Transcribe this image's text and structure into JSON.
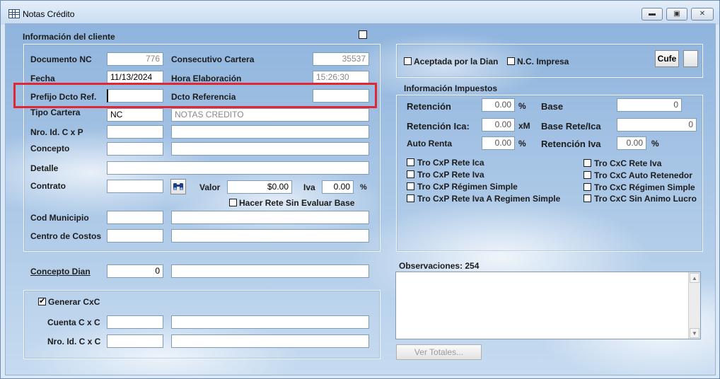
{
  "window": {
    "title": "Notas Crédito",
    "minimize_glyph": "▬",
    "restore_glyph": "▣",
    "close_glyph": "✕"
  },
  "cliente": {
    "title": "Información del cliente",
    "documento_nc_label": "Documento NC",
    "documento_nc_value": "776",
    "consecutivo_label": "Consecutivo Cartera",
    "consecutivo_value": "35537",
    "fecha_label": "Fecha",
    "fecha_value": "11/13/2024",
    "hora_label": "Hora Elaboración",
    "hora_value": "15:26:30",
    "prefijo_label": "Prefijo Dcto Ref.",
    "prefijo_value": "",
    "dcto_ref_label": "Dcto Referencia",
    "dcto_ref_value": "",
    "tipo_cartera_label": "Tipo Cartera",
    "tipo_cartera_code": "NC",
    "tipo_cartera_desc": "NOTAS CREDITO",
    "nro_id_label": "Nro. Id.  C x P",
    "nro_id_value": "",
    "nro_id_desc": "",
    "concepto_label": "Concepto",
    "concepto_value": "",
    "concepto_desc": "",
    "detalle_label": "Detalle",
    "detalle_value": "",
    "contrato_label": "Contrato",
    "contrato_value": "",
    "search_icon": "binoculars-icon",
    "valor_label": "Valor",
    "valor_value": "$0.00",
    "iva_label": "Iva",
    "iva_value": "0.00",
    "iva_unit": "%",
    "hacer_rete_label": "Hacer Rete Sin Evaluar Base",
    "hacer_rete_checked": false,
    "cod_municipio_label": "Cod Municipio",
    "cod_municipio_value": "",
    "cod_municipio_desc": "",
    "centro_costos_label": "Centro de Costos",
    "centro_costos_value": "",
    "centro_costos_desc": ""
  },
  "concepto_dian": {
    "label": "Concepto Dian",
    "value": "0",
    "desc": ""
  },
  "cxc": {
    "generar_label": "Generar CxC",
    "generar_checked": true,
    "cuenta_label": "Cuenta C x C",
    "cuenta_value": "",
    "cuenta_desc": "",
    "nro_id_label": "Nro. Id.  C x C",
    "nro_id_value": "",
    "nro_id_desc": ""
  },
  "dian": {
    "aceptada_label": "Aceptada por la Dian",
    "aceptada_checked": false,
    "nc_impresa_label": "N.C. Impresa",
    "nc_impresa_checked": false,
    "cufe_label": "Cufe"
  },
  "impuestos": {
    "title": "Información Impuestos",
    "retencion_label": "Retención",
    "retencion_value": "0.00",
    "pct": "%",
    "base_label": "Base",
    "base_value": "0",
    "retencion_ica_label": "Retención Ica:",
    "retencion_ica_value": "0.00",
    "xm": "xM",
    "base_rete_ica_label": "Base Rete/Ica",
    "base_rete_ica_value": "0",
    "auto_renta_label": "Auto Renta",
    "auto_renta_value": "0.00",
    "retencion_iva_label": "Retención Iva",
    "retencion_iva_value": "0.00",
    "checks_left": [
      "Tro CxP Rete Ica",
      "Tro CxP Rete Iva",
      "Tro CxP Régimen Simple",
      "Tro CxP Rete Iva A Regimen Simple"
    ],
    "checks_right": [
      "Tro CxC Rete Iva",
      "Tro CxC Auto Retenedor",
      "Tro CxC Régimen Simple",
      "Tro CxC Sin Animo Lucro"
    ]
  },
  "observaciones": {
    "label": "Observaciones: 254",
    "value": ""
  },
  "ver_totales_label": "Ver Totales...",
  "colors": {
    "highlight": "#e32633",
    "field_border": "#7f9db9"
  }
}
